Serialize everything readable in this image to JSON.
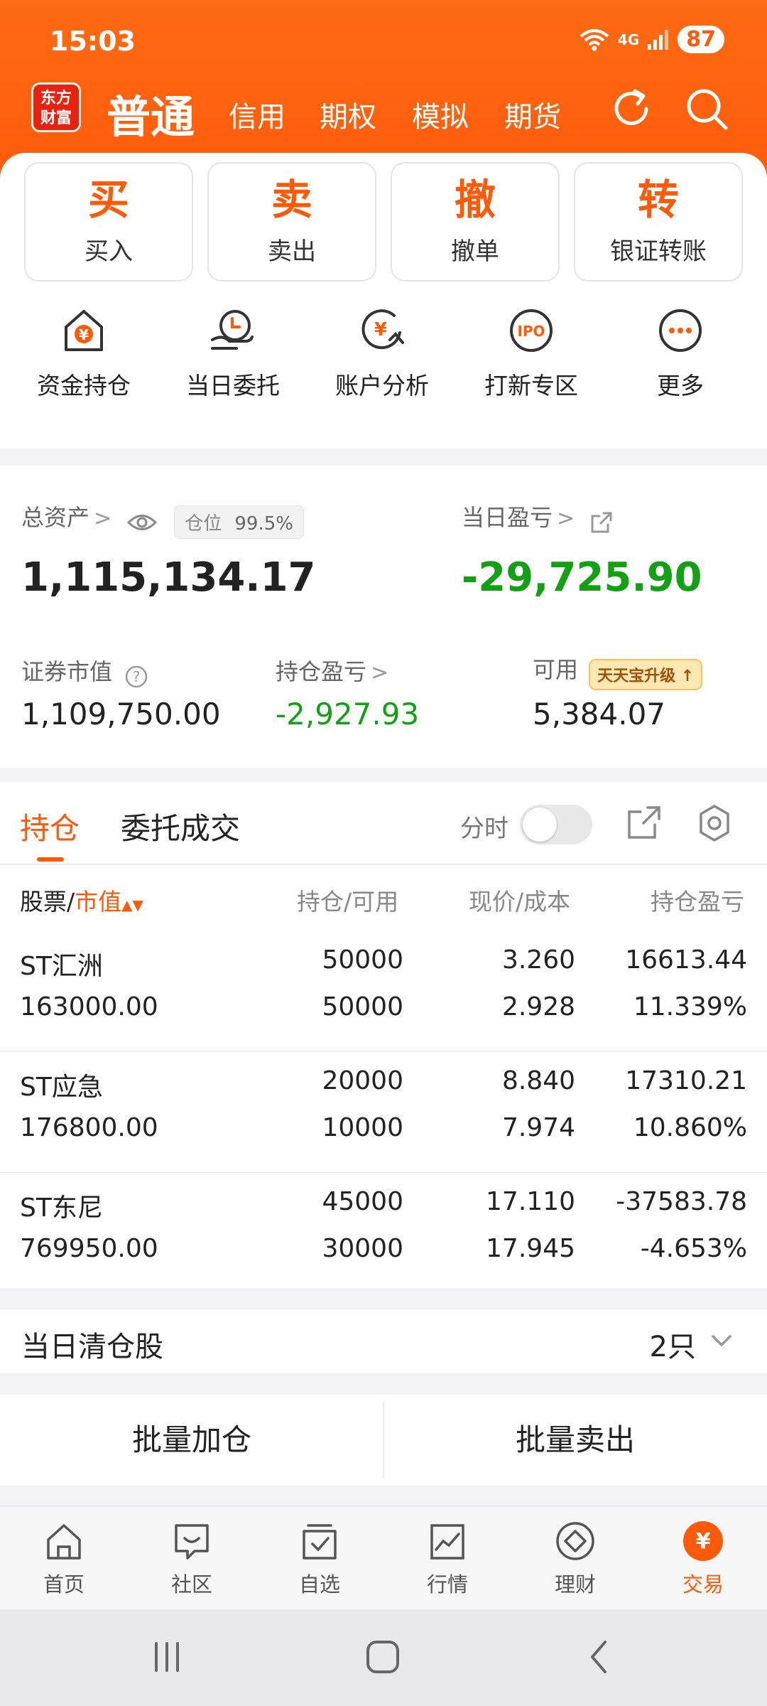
{
  "status_bar": {
    "time": "15:03",
    "network": "4G",
    "battery": "87"
  },
  "header": {
    "logo": "东方财富",
    "tabs": [
      {
        "label": "普通",
        "active": true
      },
      {
        "label": "信用",
        "active": false
      },
      {
        "label": "期权",
        "active": false
      },
      {
        "label": "模拟",
        "active": false
      },
      {
        "label": "期货",
        "active": false
      }
    ],
    "icons": [
      "refresh-icon",
      "search-icon"
    ]
  },
  "actions": [
    {
      "glyph": "买",
      "label": "买入"
    },
    {
      "glyph": "卖",
      "label": "卖出"
    },
    {
      "glyph": "撤",
      "label": "撤单"
    },
    {
      "glyph": "转",
      "label": "银证转账"
    }
  ],
  "quick_links": [
    {
      "label": "资金持仓",
      "icon": "funds-house-icon"
    },
    {
      "label": "当日委托",
      "icon": "today-order-icon"
    },
    {
      "label": "账户分析",
      "icon": "account-analysis-icon"
    },
    {
      "label": "打新专区",
      "icon": "ipo-icon"
    },
    {
      "label": "更多",
      "icon": "more-icon"
    }
  ],
  "assets": {
    "total_label": "总资产",
    "position_label": "仓位",
    "position_value": "99.5%",
    "total_value": "1,115,134.17",
    "daily_pl_label": "当日盈亏",
    "daily_pl_value": "-29,725.90",
    "market_value_label": "证券市值",
    "market_value": "1,109,750.00",
    "holding_pl_label": "持仓盈亏",
    "holding_pl_value": "-2,927.93",
    "available_label": "可用",
    "available_badge": "天天宝升级",
    "available_value": "5,384.07"
  },
  "holdings": {
    "tabs": [
      "持仓",
      "委托成交"
    ],
    "fenshi_label": "分时",
    "fenshi_on": false,
    "columns": {
      "stock": "股票/",
      "market_value": "市值",
      "qty": "持仓/可用",
      "price": "现价/成本",
      "pl": "持仓盈亏"
    },
    "rows": [
      {
        "name": "ST汇洲",
        "value": "163000.00",
        "hold": "50000",
        "avail": "50000",
        "price": "3.260",
        "cost": "2.928",
        "pl": "16613.44",
        "pl_pct": "11.339%",
        "dir": "up"
      },
      {
        "name": "ST应急",
        "value": "176800.00",
        "hold": "20000",
        "avail": "10000",
        "price": "8.840",
        "cost": "7.974",
        "pl": "17310.21",
        "pl_pct": "10.860%",
        "dir": "up"
      },
      {
        "name": "ST东尼",
        "value": "769950.00",
        "hold": "45000",
        "avail": "30000",
        "price": "17.110",
        "cost": "17.945",
        "pl": "-37583.78",
        "pl_pct": "-4.653%",
        "dir": "down"
      }
    ]
  },
  "cleared": {
    "title": "当日清仓股",
    "count": "2只"
  },
  "batch": {
    "add": "批量加仓",
    "sell": "批量卖出"
  },
  "bottom_nav": [
    {
      "label": "首页",
      "icon": "home-icon"
    },
    {
      "label": "社区",
      "icon": "community-icon"
    },
    {
      "label": "自选",
      "icon": "watchlist-icon"
    },
    {
      "label": "行情",
      "icon": "market-icon"
    },
    {
      "label": "理财",
      "icon": "wealth-icon"
    },
    {
      "label": "交易",
      "icon": "trade-icon",
      "active": true
    }
  ],
  "colors": {
    "accent": "#ff5a0a",
    "up": "#e0221e",
    "down": "#13a014"
  }
}
